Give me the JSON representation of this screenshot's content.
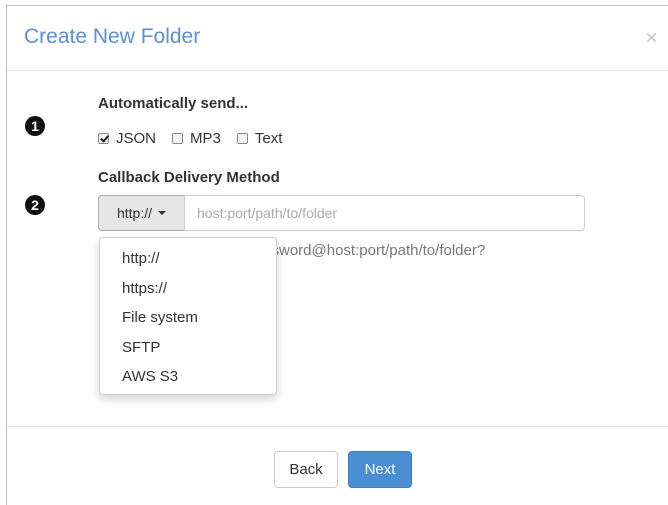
{
  "modal": {
    "title": "Create New Folder",
    "close": "×"
  },
  "step1": {
    "number": "1",
    "label": "Automatically send...",
    "options": [
      {
        "label": "JSON",
        "checked": true
      },
      {
        "label": "MP3",
        "checked": false
      },
      {
        "label": "Text",
        "checked": false
      }
    ]
  },
  "step2": {
    "number": "2",
    "label": "Callback Delivery Method",
    "protocol_selected": "http://",
    "url_placeholder": "host:port/path/to/folder",
    "help_text": "ssword@host:port/path/to/folder?",
    "dropdown_options": [
      "http://",
      "https://",
      "File system",
      "SFTP",
      "AWS S3"
    ]
  },
  "footer": {
    "back_label": "Back",
    "next_label": "Next"
  },
  "colors": {
    "title": "#5b8fd6",
    "primary_button": "#4a8fd4"
  },
  "icons": {
    "close": "close-icon",
    "caret": "caret-down-icon",
    "check": "checkmark-icon"
  }
}
